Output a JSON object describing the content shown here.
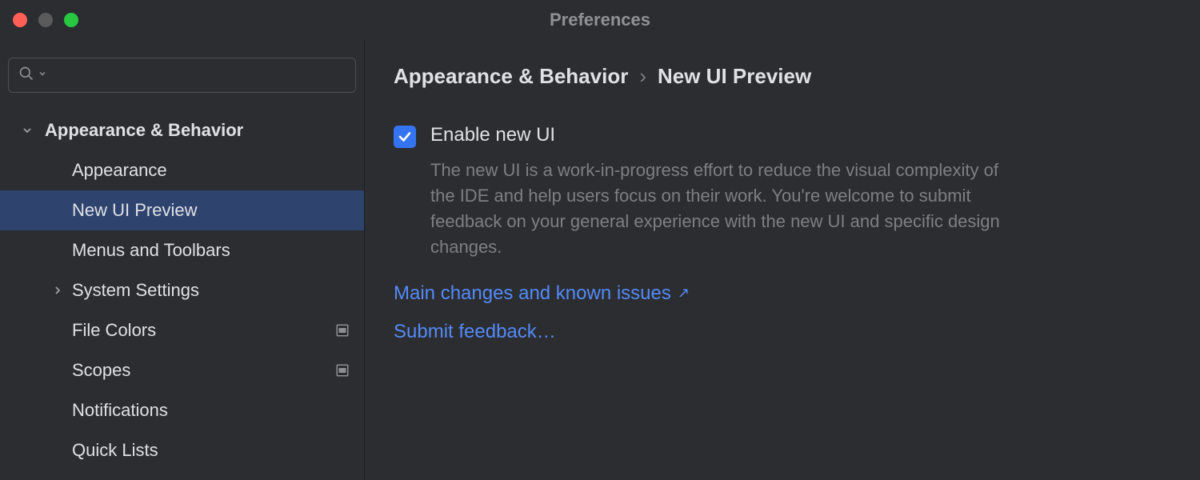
{
  "window": {
    "title": "Preferences"
  },
  "search": {
    "placeholder": ""
  },
  "sidebar": {
    "group_label": "Appearance & Behavior",
    "items": [
      {
        "label": "Appearance"
      },
      {
        "label": "New UI Preview"
      },
      {
        "label": "Menus and Toolbars"
      },
      {
        "label": "System Settings"
      },
      {
        "label": "File Colors"
      },
      {
        "label": "Scopes"
      },
      {
        "label": "Notifications"
      },
      {
        "label": "Quick Lists"
      }
    ]
  },
  "breadcrumb": {
    "parent": "Appearance & Behavior",
    "sep": "›",
    "current": "New UI Preview"
  },
  "setting": {
    "checkbox_label": "Enable new UI",
    "description": "The new UI is a work-in-progress effort to reduce the visual complexity of the IDE and help users focus on their work. You're welcome to submit feedback on your general experience with the new UI and specific design changes."
  },
  "links": {
    "changes": "Main changes and known issues",
    "feedback": "Submit feedback…"
  }
}
